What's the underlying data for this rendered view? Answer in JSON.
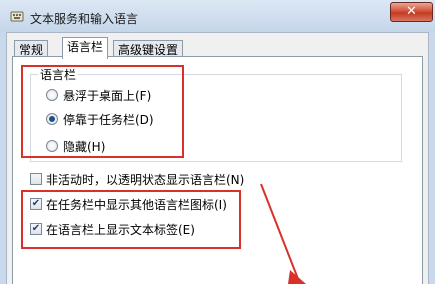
{
  "window": {
    "title": "文本服务和输入语言",
    "close_symbol": "✕",
    "icon": "keyboard-icon"
  },
  "tabs": [
    {
      "label": "常规"
    },
    {
      "label": "语言栏"
    },
    {
      "label": "高级键设置"
    }
  ],
  "language_bar_group": {
    "label": "语言栏",
    "options": [
      {
        "label": "悬浮于桌面上(F)",
        "selected": false
      },
      {
        "label": "停靠于任务栏(D)",
        "selected": true
      },
      {
        "label": "隐藏(H)",
        "selected": false
      }
    ]
  },
  "checkboxes": [
    {
      "label": "非活动时，以透明状态显示语言栏(N)",
      "checked": false
    },
    {
      "label": "在任务栏中显示其他语言栏图标(I)",
      "checked": true
    },
    {
      "label": "在语言栏上显示文本标签(E)",
      "checked": true
    }
  ],
  "colors": {
    "highlight": "#d9302a",
    "radio_dot": "#1d4f91"
  }
}
